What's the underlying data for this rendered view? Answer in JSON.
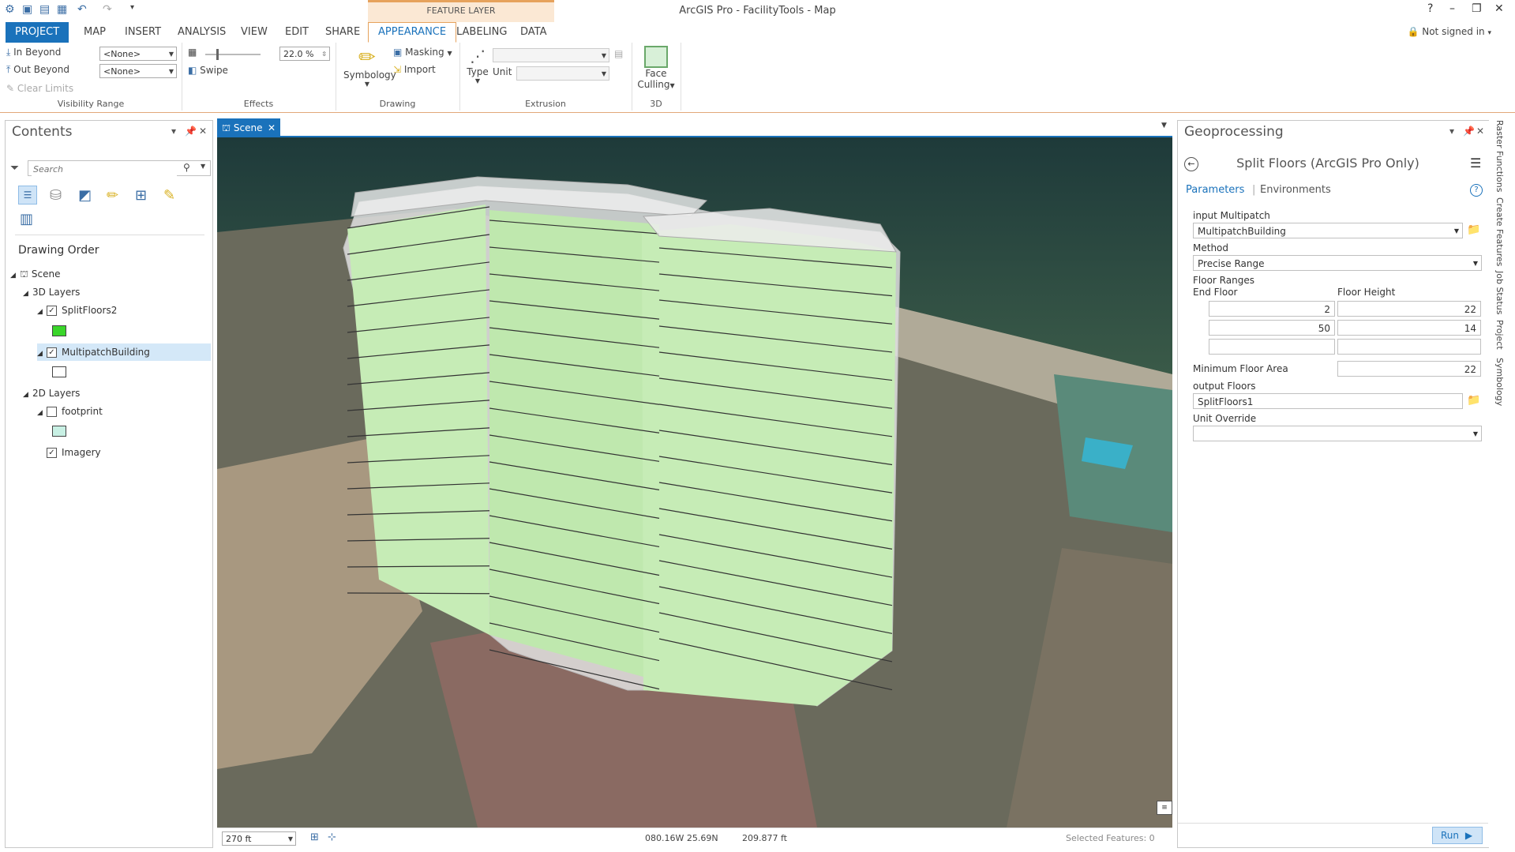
{
  "window": {
    "title": "ArcGIS Pro - FacilityTools - Map",
    "context_tab": "FEATURE LAYER",
    "help": "?",
    "minimize": "–",
    "restore": "❐",
    "close": "✕"
  },
  "tabs": [
    "PROJECT",
    "MAP",
    "INSERT",
    "ANALYSIS",
    "VIEW",
    "EDIT",
    "SHARE",
    "APPEARANCE",
    "LABELING",
    "DATA"
  ],
  "signin": "Not signed in",
  "ribbon": {
    "visibility": {
      "in_beyond": "In Beyond",
      "out_beyond": "Out Beyond",
      "clear_limits": "Clear Limits",
      "in_value": "<None>",
      "out_value": "<None>",
      "title": "Visibility Range"
    },
    "effects": {
      "transparency": "22.0 %",
      "swipe": "Swipe",
      "title": "Effects"
    },
    "drawing": {
      "symbology": "Symbology",
      "masking": "Masking",
      "import": "Import",
      "title": "Drawing"
    },
    "extrusion": {
      "type": "Type",
      "unit": "Unit",
      "title": "Extrusion"
    },
    "three_d": {
      "face_culling_1": "Face",
      "face_culling_2": "Culling",
      "title": "3D"
    }
  },
  "contents": {
    "title": "Contents",
    "search_placeholder": "Search",
    "drawing_order": "Drawing Order",
    "scene": "Scene",
    "group_3d": "3D Layers",
    "layer_split": "SplitFloors2",
    "layer_multipatch": "MultipatchBuilding",
    "group_2d": "2D Layers",
    "layer_footprint": "footprint",
    "layer_imagery": "Imagery",
    "colors": {
      "split": "#3ad62a",
      "multipatch": "#ffffff",
      "footprint": "#c8f0e4"
    }
  },
  "map": {
    "tab_label": "Scene",
    "scale": "270 ft",
    "coords": "080.16W 25.69N",
    "elevation": "209.877 ft",
    "selected": "Selected Features: 0"
  },
  "geoprocessing": {
    "title": "Geoprocessing",
    "tool_title": "Split Floors (ArcGIS Pro Only)",
    "tab_parameters": "Parameters",
    "tab_environments": "Environments",
    "input_label": "input Multipatch",
    "input_value": "MultipatchBuilding",
    "method_label": "Method",
    "method_value": "Precise Range",
    "floor_ranges": "Floor Ranges",
    "col_end_floor": "End Floor",
    "col_floor_height": "Floor Height",
    "rows": [
      {
        "end": "2",
        "height": "22"
      },
      {
        "end": "50",
        "height": "14"
      }
    ],
    "min_area_label": "Minimum Floor Area",
    "min_area_value": "22",
    "output_label": "output Floors",
    "output_value": "SplitFloors1",
    "unit_override": "Unit Override",
    "run": "Run"
  },
  "side_tabs": [
    "Raster Functions",
    "Create Features",
    "Job Status",
    "Project",
    "Symbology"
  ]
}
